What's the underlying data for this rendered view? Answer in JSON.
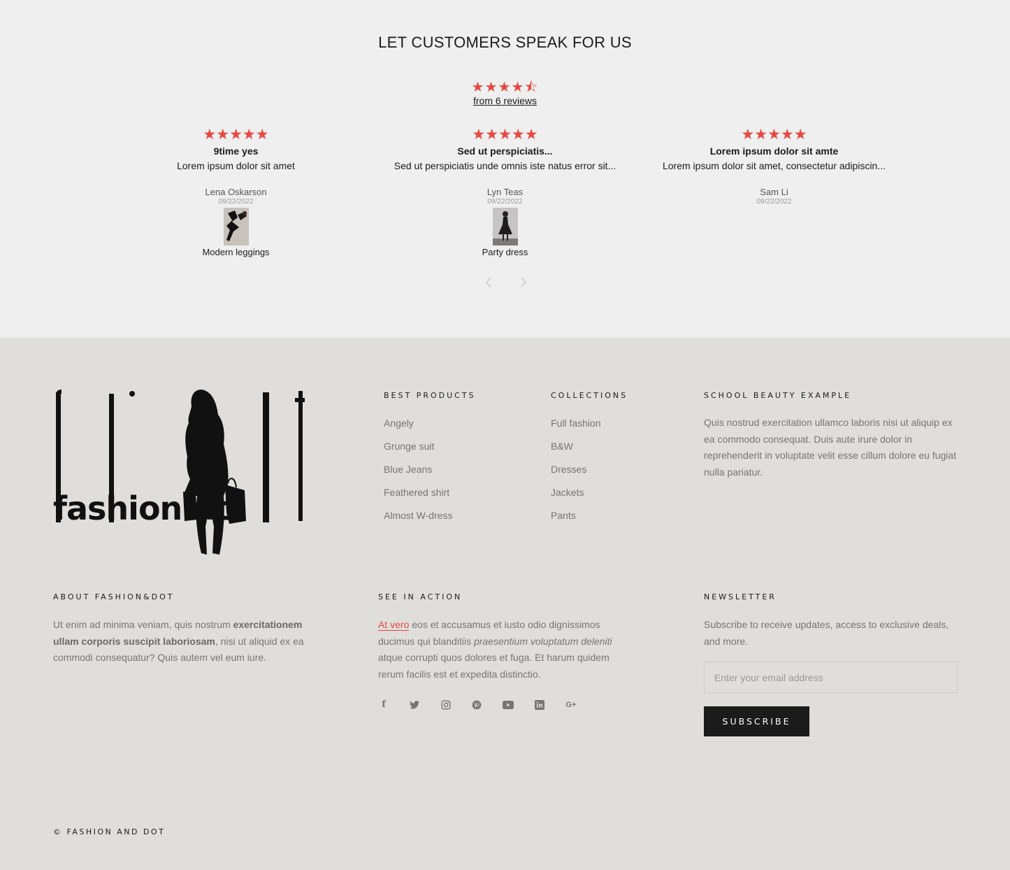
{
  "reviews": {
    "title": "LET CUSTOMERS SPEAK FOR US",
    "average_stars": "★★★★⯪",
    "average_rating": 4.5,
    "count_label": "from 6 reviews",
    "items": [
      {
        "stars": "★★★★★",
        "title": "9time yes",
        "body": "Lorem ipsum dolor sit amet",
        "author": "Lena Oskarson",
        "date": "09/22/2022",
        "product": "Modern leggings"
      },
      {
        "stars": "★★★★★",
        "title": "Sed ut perspiciatis...",
        "body": "Sed ut perspiciatis unde omnis iste natus error sit...",
        "author": "Lyn Teas",
        "date": "09/22/2022",
        "product": "Party dress"
      },
      {
        "stars": "★★★★★",
        "title": "Lorem ipsum dolor sit amte",
        "body": "Lorem ipsum dolor sit amet, consectetur adipiscin...",
        "author": "Sam Li",
        "date": "09/22/2022",
        "product": ""
      }
    ],
    "prev_icon": "‹",
    "next_icon": "›"
  },
  "footer": {
    "logo_text": "fashion dol",
    "best_products": {
      "title": "BEST PRODUCTS",
      "links": [
        "Angely",
        "Grunge suit",
        "Blue Jeans",
        "Feathered shirt",
        "Almost W-dress"
      ]
    },
    "collections": {
      "title": "COLLECTIONS",
      "links": [
        "Full fashion",
        "B&W",
        "Dresses",
        "Jackets",
        "Pants"
      ]
    },
    "school_beauty": {
      "title": "SCHOOL BEAUTY EXAMPLE",
      "text": "Quis nostrud exercitation ullamco laboris nisi ut aliquip ex ea commodo consequat. Duis aute irure dolor in reprehenderit in voluptate velit esse cillum dolore eu fugiat nulla pariatur."
    },
    "about": {
      "title": "ABOUT FASHION&DOT",
      "text_1": "Ut enim ad minima veniam, quis nostrum ",
      "text_bold": "exercitationem ullam corporis suscipit laboriosam",
      "text_2": ", nisi ut aliquid ex ea commodi consequatur? Quis autem vel eum iure."
    },
    "see_in_action": {
      "title": "SEE IN ACTION",
      "link_text": "At vero",
      "text_1": " eos et accusamus et iusto odio dignissimos ducimus qui blanditiis ",
      "text_italic": "praesentium voluptatum deleniti",
      "text_2": " atque corrupti quos dolores et fuga. Et harum quidem rerum facilis est et expedita distinctio."
    },
    "socials": {
      "facebook": "f",
      "twitter": "🐦",
      "instagram": "◎",
      "pinterest": "℗",
      "youtube": "▶",
      "linkedin": "in",
      "google_plus": "G+"
    },
    "newsletter": {
      "title": "NEWSLETTER",
      "text": "Subscribe to receive updates, access to exclusive deals, and more.",
      "placeholder": "Enter your email address",
      "button": "SUBSCRIBE"
    },
    "copyright": "© FASHION AND DOT"
  },
  "colors": {
    "accent": "#e9473f",
    "review_bg": "#efefef",
    "footer_bg": "#dfdedb",
    "text_dark": "#1c1b1b",
    "text_muted": "#777572"
  }
}
